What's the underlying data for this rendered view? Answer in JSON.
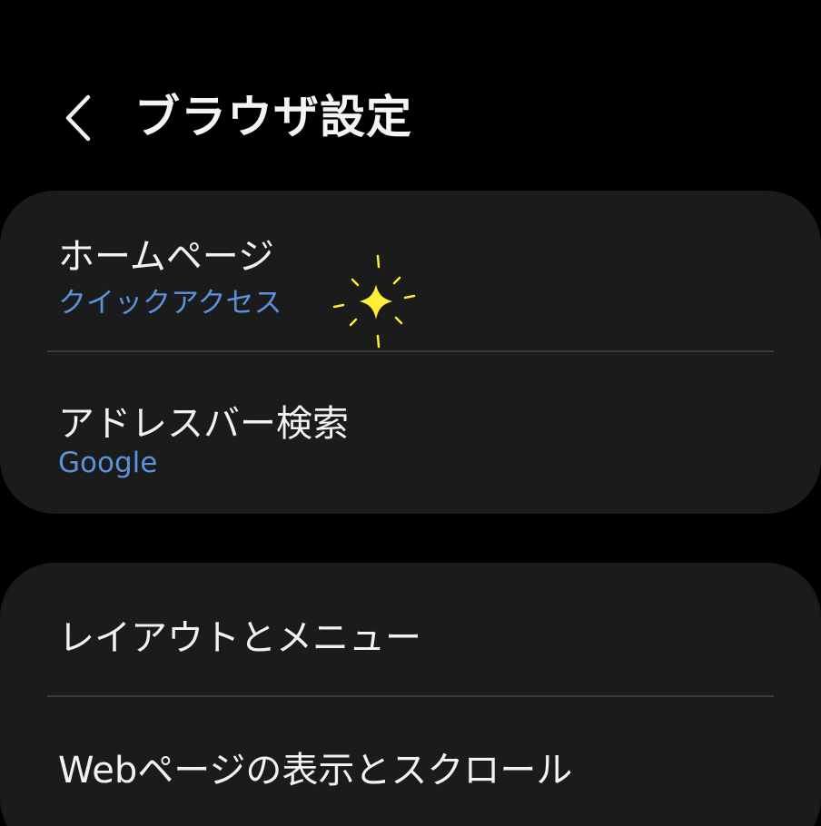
{
  "header": {
    "back_icon": "chevron-left-icon",
    "title": "ブラウザ設定"
  },
  "sections": [
    {
      "items": [
        {
          "title": "ホームページ",
          "subtitle": "クイックアクセス"
        },
        {
          "title": "アドレスバー検索",
          "subtitle": "Google"
        }
      ]
    },
    {
      "items": [
        {
          "title": "レイアウトとメニュー"
        },
        {
          "title": "Webページの表示とスクロール"
        }
      ]
    }
  ],
  "decoration": {
    "icon": "sparkle-icon",
    "color": "#ffee33"
  },
  "colors": {
    "background": "#000000",
    "card": "#1b1b1b",
    "accent_text": "#5a93dc",
    "divider": "#3b3b3b"
  }
}
